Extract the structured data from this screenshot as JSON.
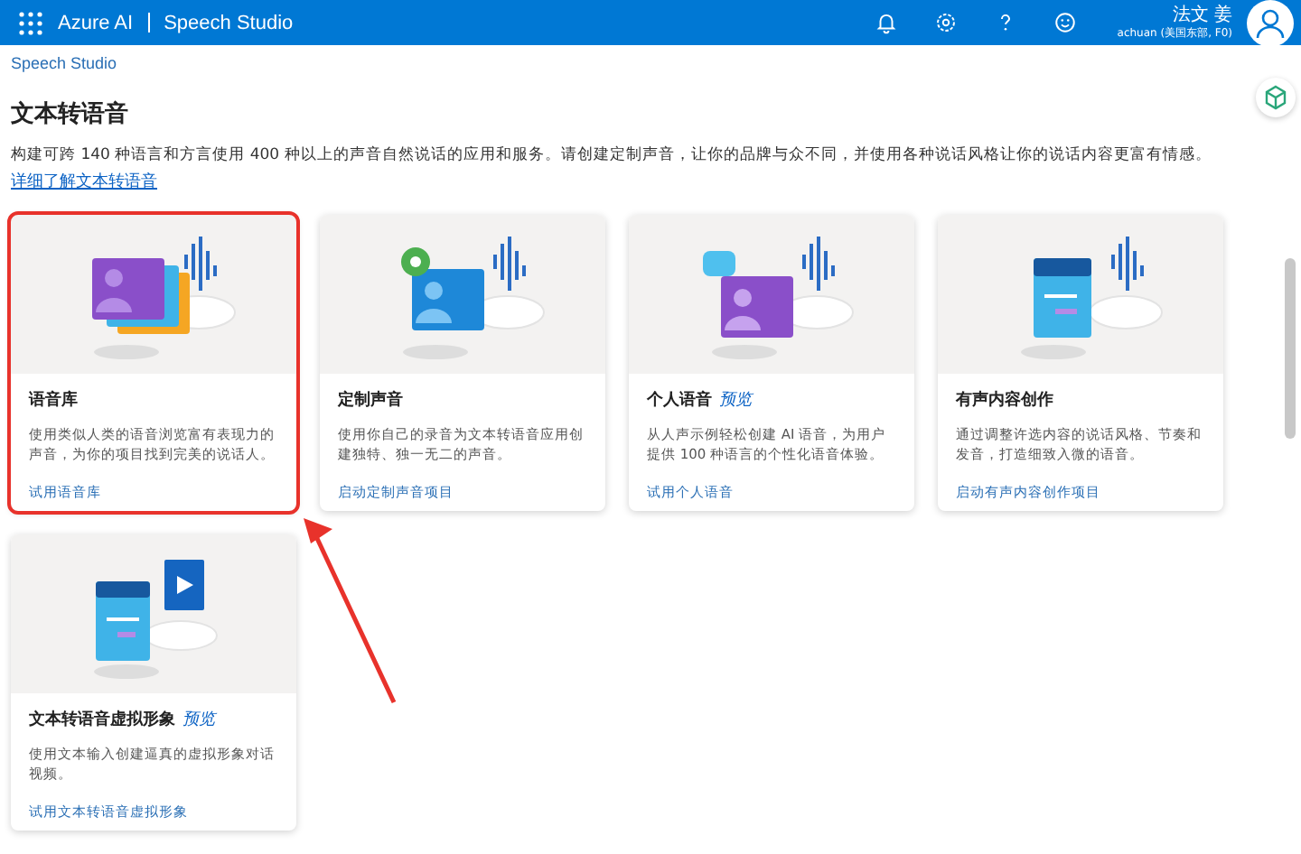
{
  "header": {
    "brand": "Azure AI",
    "product": "Speech Studio",
    "user_name": "法文 姜",
    "user_sub": "achuan (美国东部, F0)"
  },
  "breadcrumb": "Speech Studio",
  "page": {
    "title": "文本转语音",
    "description": "构建可跨 140 种语言和方言使用 400 种以上的声音自然说话的应用和服务。请创建定制声音，让你的品牌与众不同，并使用各种说话风格让你的说话内容更富有情感。",
    "learn_more": "详细了解文本转语音"
  },
  "cards": [
    {
      "kind": "library",
      "title": "语音库",
      "description": "使用类似人类的语音浏览富有表现力的声音，为你的项目找到完美的说话人。",
      "link": "试用语音库",
      "highlighted": true
    },
    {
      "kind": "custom",
      "title": "定制声音",
      "description": "使用你自己的录音为文本转语音应用创建独特、独一无二的声音。",
      "link": "启动定制声音项目",
      "highlighted": false
    },
    {
      "kind": "personal",
      "title": "个人语音",
      "badge": "预览",
      "description": "从人声示例轻松创建 AI 语音，为用户提供 100 种语言的个性化语音体验。",
      "link": "试用个人语音",
      "highlighted": false
    },
    {
      "kind": "content",
      "title": "有声内容创作",
      "description": "通过调整许选内容的说话风格、节奏和发音，打造细致入微的语音。",
      "link": "启动有声内容创作项目",
      "highlighted": false
    },
    {
      "kind": "avatar",
      "title": "文本转语音虚拟形象",
      "badge": "预览",
      "description": "使用文本输入创建逼真的虚拟形象对话视频。",
      "link": "试用文本转语音虚拟形象",
      "highlighted": false
    }
  ]
}
